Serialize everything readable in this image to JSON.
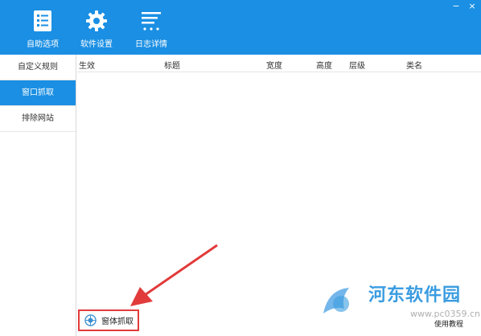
{
  "window": {
    "minimize_glyph": "−",
    "close_glyph": "×"
  },
  "toolbar": {
    "items": [
      {
        "label": "自助选项",
        "icon": "checklist-icon"
      },
      {
        "label": "软件设置",
        "icon": "gear-icon"
      },
      {
        "label": "日志详情",
        "icon": "log-list-icon"
      }
    ]
  },
  "sidebar": {
    "items": [
      {
        "label": "自定义规则",
        "active": false
      },
      {
        "label": "窗口抓取",
        "active": true
      },
      {
        "label": "排除网站",
        "active": false
      }
    ]
  },
  "table": {
    "columns": [
      "生效",
      "标题",
      "宽度",
      "高度",
      "层级",
      "类名"
    ],
    "rows": []
  },
  "bottom": {
    "capture_button": "窗体抓取",
    "help_link": "使用教程"
  },
  "watermark": {
    "title": "河东软件园",
    "subtitle": "www.pc0359.cn"
  },
  "colors": {
    "accent": "#1a8fe3",
    "annotation": "#e23b3b"
  }
}
